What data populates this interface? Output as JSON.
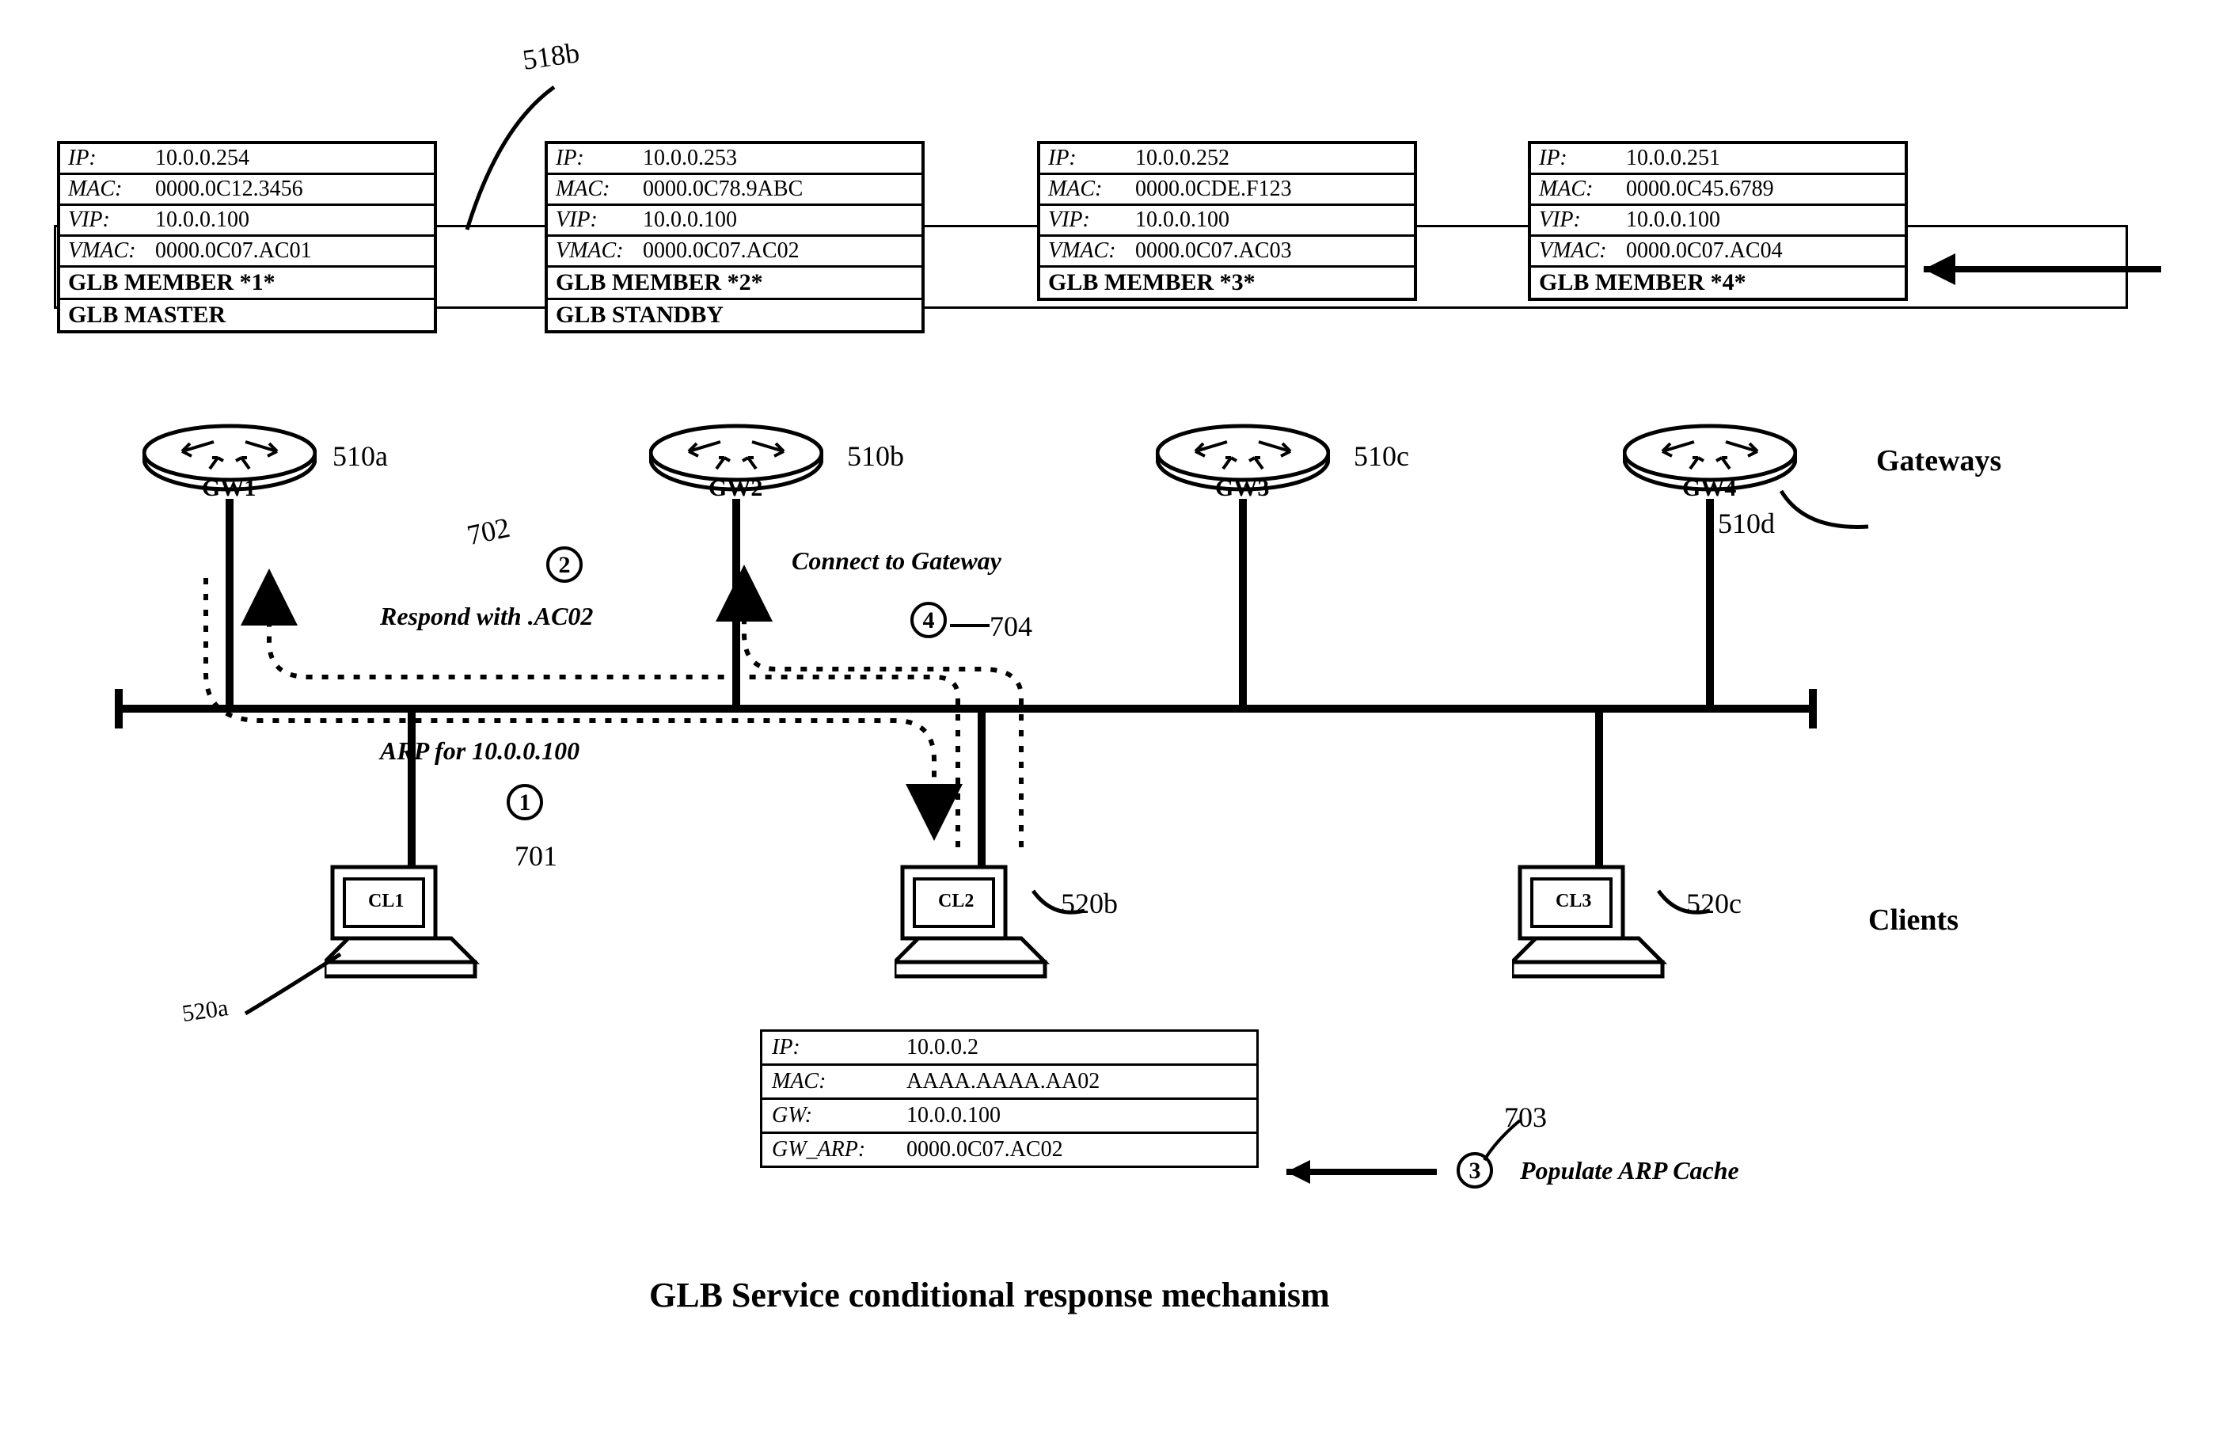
{
  "caption": "GLB Service conditional response mechanism",
  "section_labels": {
    "gateways": "Gateways",
    "clients": "Clients"
  },
  "gateways": [
    {
      "name": "GW1",
      "ip": "10.0.0.254",
      "mac": "0000.0C12.3456",
      "vip": "10.0.0.100",
      "vmac": "0000.0C07.AC01",
      "member": "GLB MEMBER *1*",
      "role": "GLB MASTER",
      "ref": "510a"
    },
    {
      "name": "GW2",
      "ip": "10.0.0.253",
      "mac": "0000.0C78.9ABC",
      "vip": "10.0.0.100",
      "vmac": "0000.0C07.AC02",
      "member": "GLB MEMBER *2*",
      "role": "GLB STANDBY",
      "ref": "510b"
    },
    {
      "name": "GW3",
      "ip": "10.0.0.252",
      "mac": "0000.0CDE.F123",
      "vip": "10.0.0.100",
      "vmac": "0000.0C07.AC03",
      "member": "GLB MEMBER *3*",
      "role": "",
      "ref": "510c"
    },
    {
      "name": "GW4",
      "ip": "10.0.0.251",
      "mac": "0000.0C45.6789",
      "vip": "10.0.0.100",
      "vmac": "0000.0C07.AC04",
      "member": "GLB MEMBER *4*",
      "role": "",
      "ref": "510d"
    }
  ],
  "labels": {
    "ip": "IP:",
    "mac": "MAC:",
    "vip": "VIP:",
    "vmac": "VMAC:",
    "gw": "GW:",
    "gw_arp": "GW_ARP:"
  },
  "clients": [
    {
      "name": "CL1",
      "ref": "520a"
    },
    {
      "name": "CL2",
      "ref": "520b"
    },
    {
      "name": "CL3",
      "ref": "520c"
    }
  ],
  "client_detail": {
    "ip": "10.0.0.2",
    "mac": "AAAA.AAAA.AA02",
    "gw": "10.0.0.100",
    "gw_arp": "0000.0C07.AC02"
  },
  "steps": {
    "1": {
      "num": "1",
      "text": "ARP for 10.0.0.100",
      "ref": "701"
    },
    "2": {
      "num": "2",
      "text": "Respond with .AC02",
      "ref": "702"
    },
    "3": {
      "num": "3",
      "text": "Populate ARP Cache",
      "ref": "703"
    },
    "4": {
      "num": "4",
      "text": "Connect to Gateway",
      "ref": "704"
    }
  },
  "annotation_518b": "518b"
}
